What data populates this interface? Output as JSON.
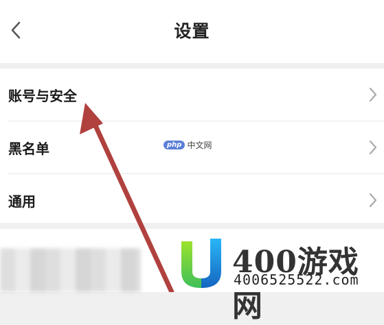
{
  "header": {
    "title": "设置",
    "back_icon": "chevron-left-icon"
  },
  "settings": {
    "items": [
      {
        "label": "账号与安全",
        "icon": "chevron-right-icon"
      },
      {
        "label": "黑名单",
        "icon": "chevron-right-icon"
      },
      {
        "label": "通用",
        "icon": "chevron-right-icon"
      }
    ]
  },
  "watermarks": {
    "php_badge": "php",
    "php_text": "中文网",
    "brand_text": "400游戏网",
    "domain_text": "4006525522.com"
  },
  "colors": {
    "arrow": "#b0413e",
    "logo_green": "#7ed321",
    "logo_blue": "#1e88e5"
  }
}
